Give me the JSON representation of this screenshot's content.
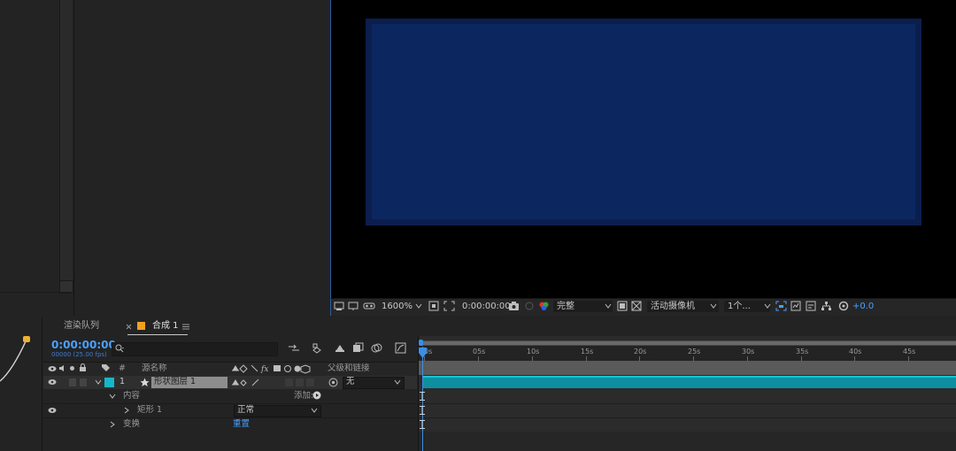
{
  "viewer_toolbar": {
    "zoom": "1600%",
    "timecode": "0:00:00:00",
    "resolution": "完整",
    "camera": "活动摄像机",
    "views": "1个...",
    "exposure": "+0.0"
  },
  "tabs": [
    {
      "label": "渲染队列"
    },
    {
      "label": "合成 1"
    }
  ],
  "timeline": {
    "current_time": "0:00:00:00",
    "frame_info": "00000 (25.00 fps)",
    "search_placeholder": "",
    "columns": {
      "index": "#",
      "source_name": "源名称",
      "parent": "父级和链接"
    },
    "layer": {
      "index": "1",
      "name": "形状图层 1",
      "parent": "无"
    },
    "contents_label": "内容",
    "add_label": "添加:",
    "rectangle_label": "矩形 1",
    "blend_mode": "正常",
    "transform_label": "变换",
    "reset_label": "重置",
    "ruler_labels": [
      "0s",
      "05s",
      "10s",
      "15s",
      "20s",
      "25s",
      "30s",
      "35s",
      "40s",
      "45s"
    ]
  },
  "colors": {
    "accent_blue": "#4aa0ff",
    "layer_label": "#15b8c9",
    "comp_bg": "#0c2760",
    "tab_orange": "#f0a020"
  }
}
